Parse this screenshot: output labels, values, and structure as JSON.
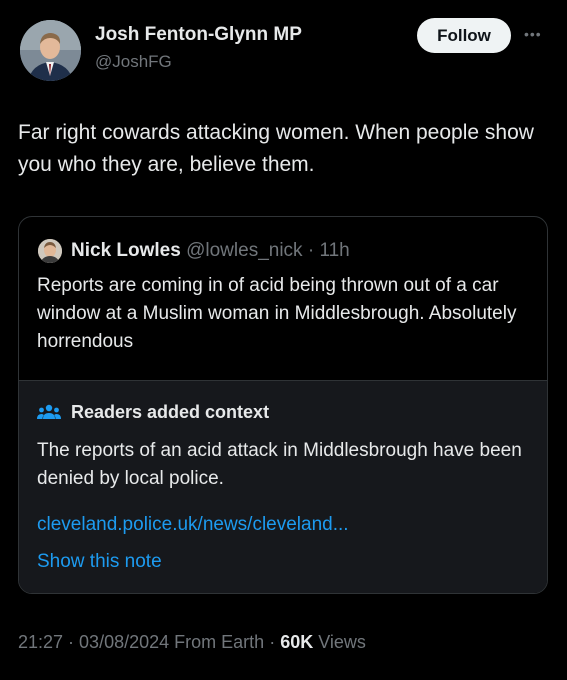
{
  "author": {
    "name": "Josh Fenton-Glynn MP",
    "handle": "@JoshFG",
    "follow_label": "Follow"
  },
  "tweet": {
    "text": "Far right cowards attacking women. When people show you who they are, believe them."
  },
  "quoted": {
    "name": "Nick Lowles",
    "handle": "@lowles_nick",
    "separator": " · ",
    "age": "11h",
    "text": "Reports are coming in of acid being thrown out of a car window at a Muslim woman in Middlesbrough. Absolutely horrendous"
  },
  "note": {
    "title": "Readers added context",
    "text": "The reports of an acid attack in Middlesbrough have been denied by local police.",
    "link": "cleveland.police.uk/news/cleveland...",
    "show_label": "Show this note"
  },
  "footer": {
    "time": "21:27",
    "date": "03/08/2024",
    "source": "From Earth",
    "views_count": "60K",
    "views_label": "Views"
  },
  "colors": {
    "background": "#000000",
    "text": "#e7e9ea",
    "muted": "#71767b",
    "link": "#1d9bf0",
    "note_bg": "#16181c"
  }
}
